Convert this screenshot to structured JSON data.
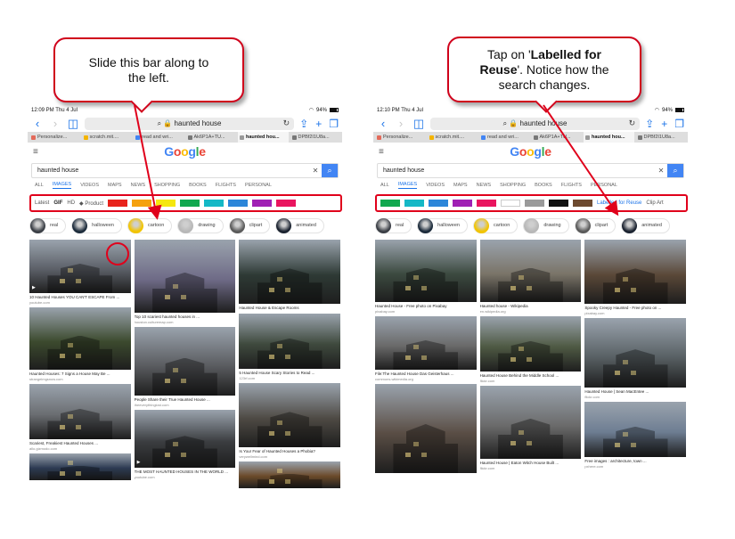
{
  "colors": {
    "accent_red": "#e0001b",
    "link_blue": "#1a73e8",
    "google_blue": "#4285f4"
  },
  "left_panel": {
    "status": {
      "time": "12:09 PM  Thu 4 Jul",
      "battery": "94%"
    },
    "url": "haunted house",
    "browser_tabs": [
      {
        "label": "Personalize...",
        "fav": "#e36a5a"
      },
      {
        "label": "scratch.mit....",
        "fav": "#f4b400"
      },
      {
        "label": "read and wri...",
        "fav": "#4285f4"
      },
      {
        "label": "Ak6P1A+TU...",
        "fav": "#777777"
      },
      {
        "label": "haunted hou...",
        "fav": "#999999",
        "active": true
      },
      {
        "label": "DPBf2I1U8a...",
        "fav": "#777777"
      }
    ],
    "search": {
      "query": "haunted house",
      "tabs": [
        "ALL",
        "IMAGES",
        "VIDEOS",
        "MAPS",
        "NEWS",
        "SHOPPING",
        "BOOKS",
        "FLIGHTS",
        "PERSONAL"
      ],
      "active_tab": "IMAGES"
    },
    "filters": {
      "labels": [
        "Latest",
        "GIF",
        "HD",
        "Product"
      ],
      "swatches": [
        "#e8231c",
        "#f5a10e",
        "#f5e70f",
        "#11a84f",
        "#15b8c6",
        "#2c86d9",
        "#a020b4",
        "#e9155f"
      ]
    },
    "chips": [
      {
        "label": "real",
        "thumb": "#3b3f46"
      },
      {
        "label": "halloween",
        "thumb": "#1d2c3c"
      },
      {
        "label": "cartoon",
        "thumb": "#f2c400"
      },
      {
        "label": "drawing",
        "thumb": "#b8b8b8"
      },
      {
        "label": "clipart",
        "thumb": "#5a5a5a"
      },
      {
        "label": "animated",
        "thumb": "#1b2330"
      }
    ],
    "columns": [
      [
        {
          "title": "10 Haunted Houses YOU CAN'T ESCAPE From ...",
          "source": "youtube.com",
          "h": 60,
          "bg": "#5c6068",
          "circle": true,
          "play": true
        },
        {
          "title": "Haunted Houses: 7 Signs a House May Be ...",
          "source": "strangeimgsnow.com",
          "h": 70,
          "bg": "#3c4a2e"
        },
        {
          "title": "Scariest, Freakiest Haunted Houses ...",
          "source": "allo.gizmodo.com",
          "h": 62,
          "bg": "#6b6e72"
        },
        {
          "title": "",
          "source": "",
          "h": 30,
          "bg": "#2c3a52"
        }
      ],
      [
        {
          "title": "Top 10 scariest haunted houses in ...",
          "source": "houston.culturemap.com",
          "h": 82,
          "bg": "#6e6a86"
        },
        {
          "title": "People Share their True Haunted House ...",
          "source": "theeverythinglost.com",
          "h": 77,
          "bg": "#5c5e62"
        },
        {
          "title": "THE MOST HAUNTED HOUSES IN THE WORLD ...",
          "source": "youtube.com",
          "h": 65,
          "bg": "#3b3d40",
          "play": true
        }
      ],
      [
        {
          "title": "Haunted House & Escape Rooms",
          "source": "",
          "h": 72,
          "bg": "#2e3a35"
        },
        {
          "title": "5 Haunted House Scary Stories to Read ...",
          "source": "123rf.com",
          "h": 62,
          "bg": "#3f4a3e"
        },
        {
          "title": "Is Your Fear of Haunted Houses a Phobia?",
          "source": "verywellmind.com",
          "h": 72,
          "bg": "#4e4a44"
        },
        {
          "title": "",
          "source": "",
          "h": 30,
          "bg": "#6b4a2a"
        }
      ]
    ]
  },
  "right_panel": {
    "status": {
      "time": "12:10 PM  Thu 4 Jul",
      "battery": "94%"
    },
    "url": "haunted house",
    "browser_tabs": [
      {
        "label": "Personalize...",
        "fav": "#e36a5a"
      },
      {
        "label": "scratch.mit....",
        "fav": "#f4b400"
      },
      {
        "label": "read and wri...",
        "fav": "#4285f4"
      },
      {
        "label": "Ak6P1A+TU...",
        "fav": "#777777"
      },
      {
        "label": "haunted hou...",
        "fav": "#999999",
        "active": true
      },
      {
        "label": "DPBf2I1U8a...",
        "fav": "#777777"
      }
    ],
    "search": {
      "query": "haunted house",
      "tabs": [
        "ALL",
        "IMAGES",
        "VIDEOS",
        "MAPS",
        "NEWS",
        "SHOPPING",
        "BOOKS",
        "FLIGHTS",
        "PERSONAL"
      ],
      "active_tab": "IMAGES"
    },
    "filters": {
      "swatches": [
        "#11a84f",
        "#15b8c6",
        "#2c86d9",
        "#a020b4",
        "#e9155f",
        "#ffffff",
        "#9a9a9a",
        "#111111",
        "#6d4a2f"
      ],
      "links": [
        "Labelled for Reuse",
        "Clip Art"
      ]
    },
    "chips": [
      {
        "label": "real",
        "thumb": "#3b3f46"
      },
      {
        "label": "halloween",
        "thumb": "#1d2c3c"
      },
      {
        "label": "cartoon",
        "thumb": "#f2c400"
      },
      {
        "label": "drawing",
        "thumb": "#b8b8b8"
      },
      {
        "label": "clipart",
        "thumb": "#5a5a5a"
      },
      {
        "label": "animated",
        "thumb": "#1b2330"
      }
    ],
    "columns": [
      [
        {
          "title": "Haunted House - Free photo on Pixabay",
          "source": "pixabay.com",
          "h": 70,
          "bg": "#3c4a40"
        },
        {
          "title": "File:The Haunted House Das Geisterhaus ...",
          "source": "commons.wikimedia.org",
          "h": 60,
          "bg": "#6a6a6a"
        },
        {
          "title": "",
          "source": "",
          "h": 100,
          "bg": "#5a4e45"
        }
      ],
      [
        {
          "title": "Haunted house - Wikipedia",
          "source": "en.wikipedia.org",
          "h": 70,
          "bg": "#7a7468"
        },
        {
          "title": "Haunted House Behind the Middle School ...",
          "source": "flickr.com",
          "h": 62,
          "bg": "#4f5a44"
        },
        {
          "title": "Haunted House | Eaton Witch House Built ...",
          "source": "flickr.com",
          "h": 82,
          "bg": "#6a6a6a"
        }
      ],
      [
        {
          "title": "Spooky Creepy Haunted - Free photo on ...",
          "source": "pixabay.com",
          "h": 72,
          "bg": "#5a4838"
        },
        {
          "title": "Haunted House | Sean MacEntee ...",
          "source": "flickr.com",
          "h": 78,
          "bg": "#5a6266"
        },
        {
          "title": "Free images : architecture, town ...",
          "source": "pxhere.com",
          "h": 62,
          "bg": "#6d7d92"
        }
      ]
    ]
  },
  "callouts": {
    "left": {
      "text": "Slide this bar along to the left."
    },
    "right": {
      "text_before": "Tap on '",
      "text_bold": "Labelled for Reuse",
      "text_after": "'. Notice how the search changes."
    }
  },
  "google_logo": [
    {
      "ch": "G",
      "color": "#4285f4"
    },
    {
      "ch": "o",
      "color": "#ea4335"
    },
    {
      "ch": "o",
      "color": "#fbbc05"
    },
    {
      "ch": "g",
      "color": "#4285f4"
    },
    {
      "ch": "l",
      "color": "#34a853"
    },
    {
      "ch": "e",
      "color": "#ea4335"
    }
  ],
  "icons": {
    "back": "back-arrow-icon",
    "forward": "forward-arrow-icon",
    "bookmarks": "book-icon",
    "share": "share-icon",
    "new_tab": "plus-icon",
    "tabs": "tabs-icon",
    "menu": "hamburger-icon",
    "search": "search-icon",
    "clear": "close-icon",
    "reload": "reload-icon"
  }
}
